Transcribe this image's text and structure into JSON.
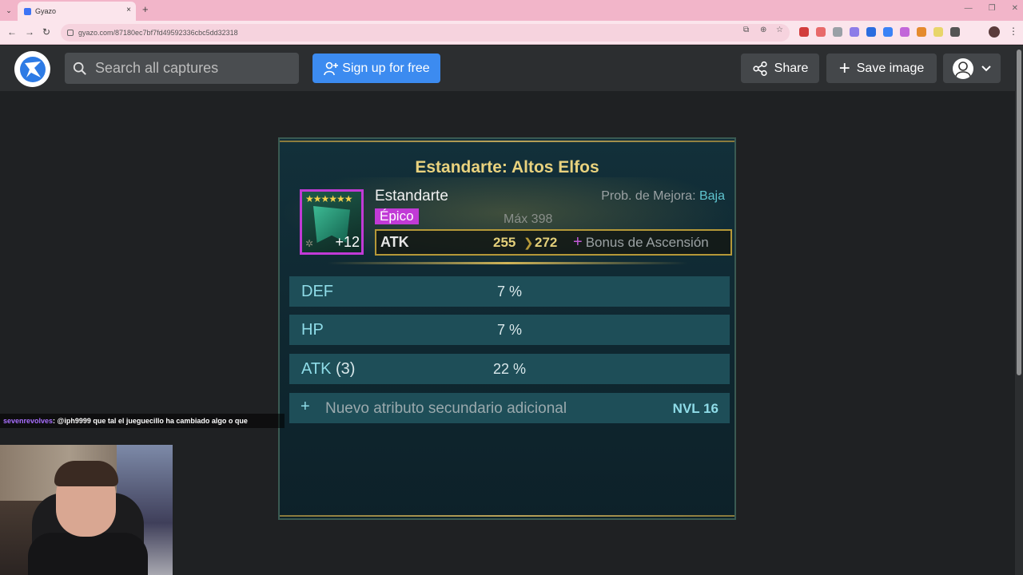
{
  "browser": {
    "tab_title": "Gyazo",
    "tab_close": "×",
    "new_tab": "+",
    "url": "gyazo.com/87180ec7bf7fd49592336cbc5dd32318",
    "window_controls": [
      "—",
      "❐",
      "✕"
    ]
  },
  "header": {
    "search_placeholder": "Search all captures",
    "signup_label": "Sign up for free",
    "share_label": "Share",
    "save_label": "Save image"
  },
  "panel": {
    "title": "Estandarte: Altos Elfos",
    "item": {
      "name": "Estandarte",
      "rarity": "Épico",
      "stars": "★★★★★★",
      "level": "+12",
      "upgrade_chance_label": "Prob. de Mejora:",
      "upgrade_chance_value": "Baja",
      "max_label": "Máx 398"
    },
    "main_stat": {
      "name": "ATK",
      "from": "255",
      "to": "272",
      "bonus_label": "Bonus de Ascensión"
    },
    "substats": [
      {
        "name": "DEF",
        "count": "",
        "value": "7 %"
      },
      {
        "name": "HP",
        "count": "",
        "value": "7 %"
      },
      {
        "name": "ATK",
        "count": "(3)",
        "value": "22 %"
      }
    ],
    "add_substat": {
      "label": "Nuevo atributo secundario adicional",
      "level": "NVL 16"
    }
  },
  "overlay": {
    "chat_user": "sevenrevolves",
    "chat_message": ": @iph9999 que tal el jueguecillo ha cambiado algo o que"
  },
  "colors": {
    "accent_blue": "#3c8bf0",
    "rarity_epic": "#c13ad6",
    "gold": "#e9d27e",
    "teal": "#8fdce8"
  }
}
